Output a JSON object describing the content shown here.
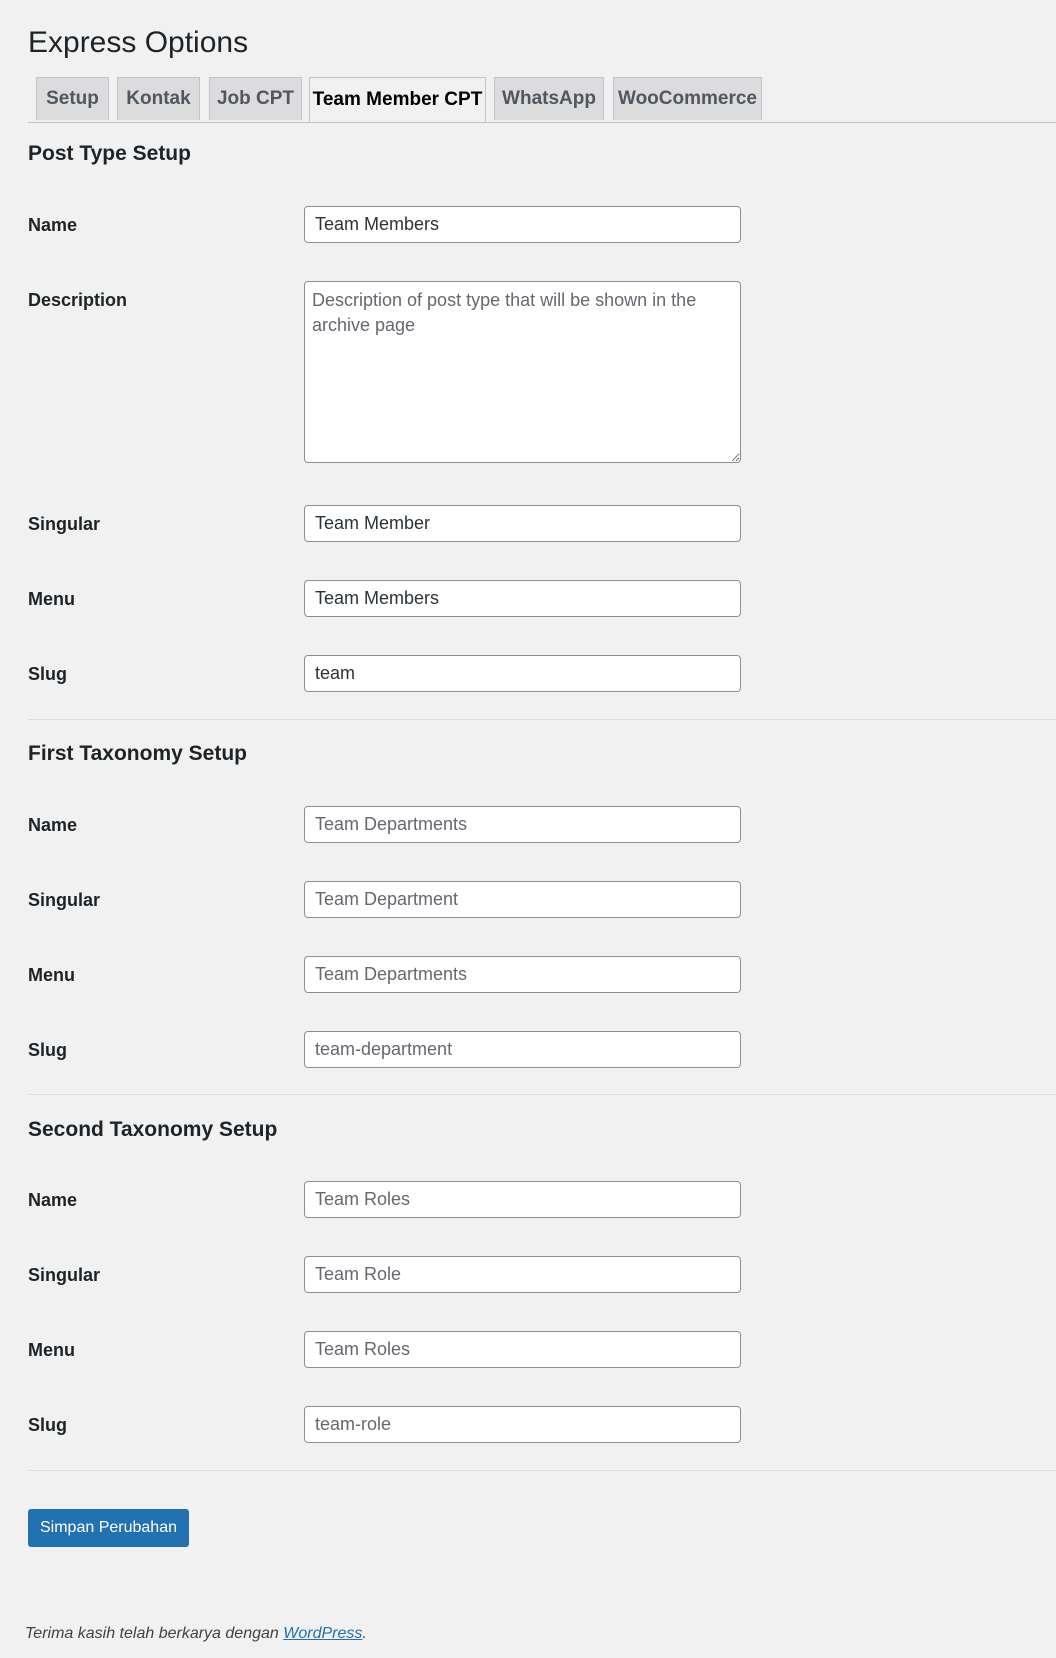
{
  "page": {
    "title": "Express Options"
  },
  "tabs": [
    {
      "label": "Setup"
    },
    {
      "label": "Kontak"
    },
    {
      "label": "Job CPT"
    },
    {
      "label": "Team Member CPT",
      "active": true
    },
    {
      "label": "WhatsApp"
    },
    {
      "label": "WooCommerce"
    }
  ],
  "post_type": {
    "heading": "Post Type Setup",
    "name": {
      "label": "Name",
      "value": "Team Members"
    },
    "description": {
      "label": "Description",
      "placeholder": "Description of post type that will be shown in the archive page"
    },
    "singular": {
      "label": "Singular",
      "value": "Team Member"
    },
    "menu": {
      "label": "Menu",
      "value": "Team Members"
    },
    "slug": {
      "label": "Slug",
      "value": "team"
    }
  },
  "first_taxonomy": {
    "heading": "First Taxonomy Setup",
    "name": {
      "label": "Name",
      "placeholder": "Team Departments"
    },
    "singular": {
      "label": "Singular",
      "placeholder": "Team Department"
    },
    "menu": {
      "label": "Menu",
      "placeholder": "Team Departments"
    },
    "slug": {
      "label": "Slug",
      "placeholder": "team-department"
    }
  },
  "second_taxonomy": {
    "heading": "Second Taxonomy Setup",
    "name": {
      "label": "Name",
      "placeholder": "Team Roles"
    },
    "singular": {
      "label": "Singular",
      "placeholder": "Team Role"
    },
    "menu": {
      "label": "Menu",
      "placeholder": "Team Roles"
    },
    "slug": {
      "label": "Slug",
      "placeholder": "team-role"
    }
  },
  "save_button": "Simpan Perubahan",
  "footer": {
    "text": "Terima kasih telah berkarya dengan ",
    "link": "WordPress",
    "suffix": "."
  },
  "colors": {
    "primary": "#2271b1",
    "background": "#f1f1f1",
    "tab_inactive": "#dcdcde"
  }
}
